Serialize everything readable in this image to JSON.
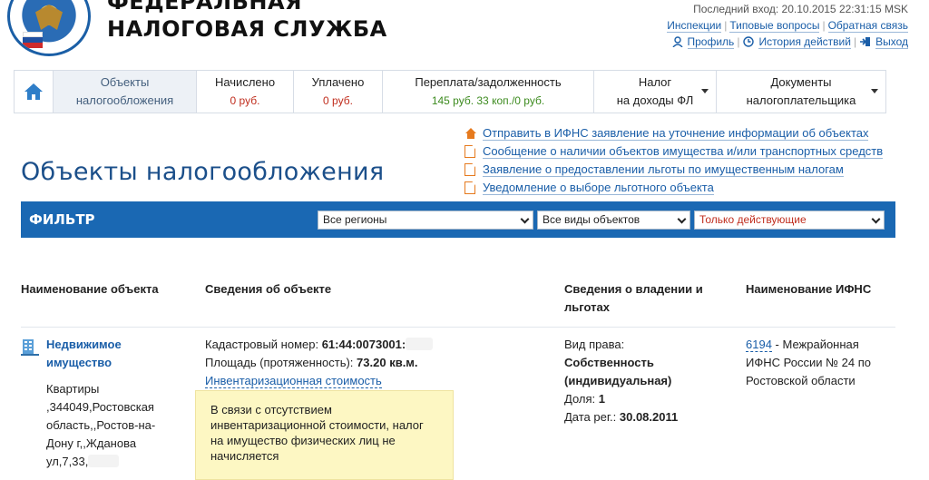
{
  "header": {
    "service_name_line1": "ФЕДЕРАЛЬНАЯ",
    "service_name_line2": "НАЛОГОВАЯ СЛУЖБА",
    "last_login_label": "Последний вход:",
    "last_login_value": "20.10.2015 22:31:15 MSK",
    "links_row1": [
      "Инспекции",
      "Типовые вопросы",
      "Обратная связь"
    ],
    "profile": "Профиль",
    "history": "История действий",
    "logout": "Выход"
  },
  "tabs": [
    {
      "label": "Объекты",
      "sub": "налогообложения"
    },
    {
      "label": "Начислено",
      "sub": "0 руб."
    },
    {
      "label": "Уплачено",
      "sub": "0 руб."
    },
    {
      "label": "Переплата/задолженность",
      "sub": "145 руб. 33 коп./0 руб."
    },
    {
      "label": "Налог",
      "sub": "на доходы ФЛ"
    },
    {
      "label": "Документы",
      "sub": "налогоплательщика"
    }
  ],
  "actions": [
    "Отправить в ИФНС заявление на уточнение информации об объектах",
    "Сообщение о наличии объектов имущества и/или транспортных средств",
    "Заявление о предоставлении льготы по имущественным налогам",
    "Уведомление о выборе льготного объекта"
  ],
  "page_title": "Объекты налогообложения",
  "filter": {
    "label": "ФИЛЬТР",
    "region": "Все регионы",
    "object_type": "Все виды объектов",
    "status": "Только действующие"
  },
  "table": {
    "headers": [
      "Наименование объекта",
      "Сведения об объекте",
      "Сведения о владении и льготах",
      "Наименование ИФНС"
    ],
    "row": {
      "name_line1": "Недвижимое",
      "name_line2": "имущество",
      "address": [
        "Квартиры",
        ",344049,Ростовская",
        "область,,Ростов-на-",
        "Дону г,,Жданова",
        "ул,7,33,"
      ],
      "cadastral_label": "Кадастровый номер:",
      "cadastral_value": "61:44:0073001:",
      "area_label": "Площадь (протяженность):",
      "area_value": "73.20 кв.м.",
      "inventory_link": "Инвентаризационная стоимость",
      "right_label": "Вид права:",
      "right_value_1": "Собственность",
      "right_value_2": "(индивидуальная)",
      "share_label": "Доля:",
      "share_value": "1",
      "reg_label": "Дата рег.:",
      "reg_value": "30.08.2011",
      "ifns_code": "6194",
      "ifns_name_1": " - Межрайонная",
      "ifns_name_2": "ИФНС России № 24 по",
      "ifns_name_3": "Ростовской области"
    }
  },
  "tooltip": [
    "В связи с отсутствием",
    "инвентаризационной стоимости, налог",
    "на имущество физических лиц не",
    "начисляется"
  ]
}
